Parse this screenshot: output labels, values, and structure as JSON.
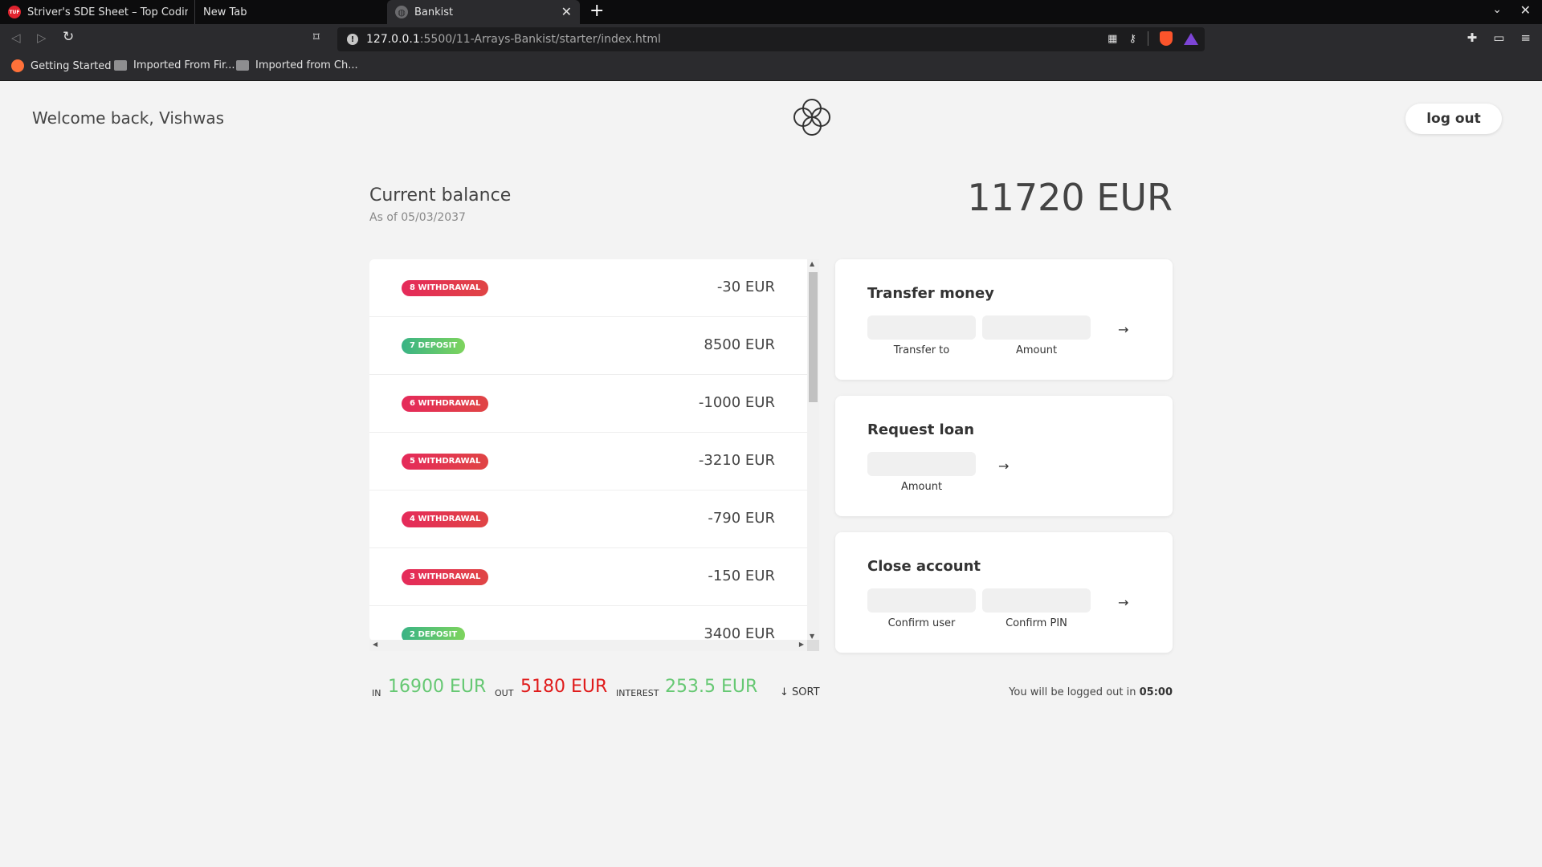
{
  "browser": {
    "tabs": [
      {
        "label": "Striver's SDE Sheet – Top Coding Interview Problems"
      },
      {
        "label": "New Tab"
      },
      {
        "label": "Bankist"
      }
    ],
    "url_host": "127.0.0.1",
    "url_path": ":5500/11-Arrays-Bankist/starter/index.html",
    "bookmarks": [
      {
        "label": "Getting Started"
      },
      {
        "label": "Imported From Fir..."
      },
      {
        "label": "Imported from Ch..."
      }
    ]
  },
  "app": {
    "welcome": "Welcome back, Vishwas",
    "logout_label": "log out",
    "balance": {
      "title": "Current balance",
      "date": "As of 05/03/2037",
      "value": "11720 EUR"
    },
    "movements": [
      {
        "type": "8 withdrawal",
        "kind": "withdrawal",
        "value": "-30 EUR"
      },
      {
        "type": "7 deposit",
        "kind": "deposit",
        "value": "8500 EUR"
      },
      {
        "type": "6 withdrawal",
        "kind": "withdrawal",
        "value": "-1000 EUR"
      },
      {
        "type": "5 withdrawal",
        "kind": "withdrawal",
        "value": "-3210 EUR"
      },
      {
        "type": "4 withdrawal",
        "kind": "withdrawal",
        "value": "-790 EUR"
      },
      {
        "type": "3 withdrawal",
        "kind": "withdrawal",
        "value": "-150 EUR"
      },
      {
        "type": "2 deposit",
        "kind": "deposit",
        "value": "3400 EUR"
      }
    ],
    "transfer": {
      "title": "Transfer money",
      "to_label": "Transfer to",
      "amount_label": "Amount",
      "button": "→"
    },
    "loan": {
      "title": "Request loan",
      "amount_label": "Amount",
      "button": "→"
    },
    "close": {
      "title": "Close account",
      "user_label": "Confirm user",
      "pin_label": "Confirm PIN",
      "button": "→"
    },
    "summary": {
      "in_label": "In",
      "in_value": "16900 EUR",
      "out_label": "Out",
      "out_value": "5180 EUR",
      "interest_label": "Interest",
      "interest_value": "253.5 EUR",
      "sort_label": "↓ SORT"
    },
    "timer": {
      "text": "You will be logged out in ",
      "value": "05:00"
    }
  },
  "colors": {
    "withdrawal": "#e52a5a",
    "deposit": "#39b385",
    "in": "#66c873",
    "out": "#e01b1b"
  }
}
